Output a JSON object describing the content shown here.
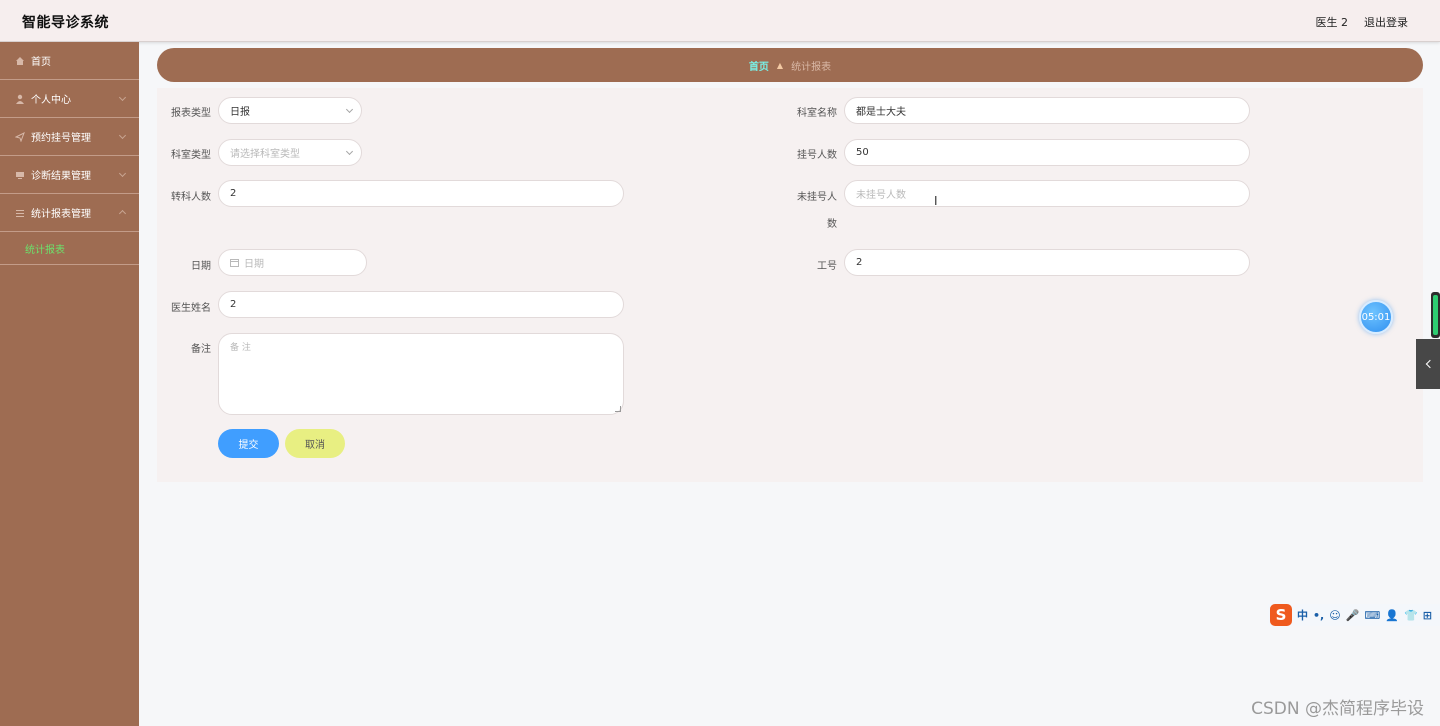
{
  "header": {
    "title": "智能导诊系统",
    "user": "医生 2",
    "logout": "退出登录"
  },
  "sidebar": {
    "items": [
      {
        "label": "首页",
        "icon": "home-icon"
      },
      {
        "label": "个人中心",
        "icon": "user-icon"
      },
      {
        "label": "预约挂号管理",
        "icon": "send-icon"
      },
      {
        "label": "诊断结果管理",
        "icon": "monitor-icon"
      },
      {
        "label": "统计报表管理",
        "icon": "menu-icon"
      }
    ],
    "active_sub": "统计报表"
  },
  "breadcrumb": {
    "home": "首页",
    "current": "统计报表"
  },
  "form": {
    "report_type": {
      "label": "报表类型",
      "value": "日报"
    },
    "dept_name": {
      "label": "科室名称",
      "value": "都是士大夫"
    },
    "dept_type": {
      "label": "科室类型",
      "placeholder": "请选择科室类型"
    },
    "registered": {
      "label": "挂号人数",
      "value": "50"
    },
    "transfer": {
      "label": "转科人数",
      "value": "2"
    },
    "unregistered": {
      "label_line1": "未挂号人",
      "label_line2": "数",
      "placeholder": "未挂号人数"
    },
    "date": {
      "label": "日期",
      "placeholder": "日期"
    },
    "job_no": {
      "label": "工号",
      "value": "2"
    },
    "doctor_name": {
      "label": "医生姓名",
      "value": "2"
    },
    "remark": {
      "label": "备注",
      "placeholder": "备 注"
    },
    "submit": "提交",
    "cancel": "取消"
  },
  "widgets": {
    "timer": "05:01",
    "ime_chars": [
      "中",
      "•,",
      "☺",
      "🎤",
      "⌨",
      "👤",
      "👕",
      "⊞"
    ],
    "ime_logo": "S"
  },
  "watermark": "CSDN @杰简程序毕设",
  "colors": {
    "sidebar": "#9e6c52",
    "accent_green": "#6ce26c",
    "submit": "#409eff",
    "cancel": "#e8ef82"
  }
}
